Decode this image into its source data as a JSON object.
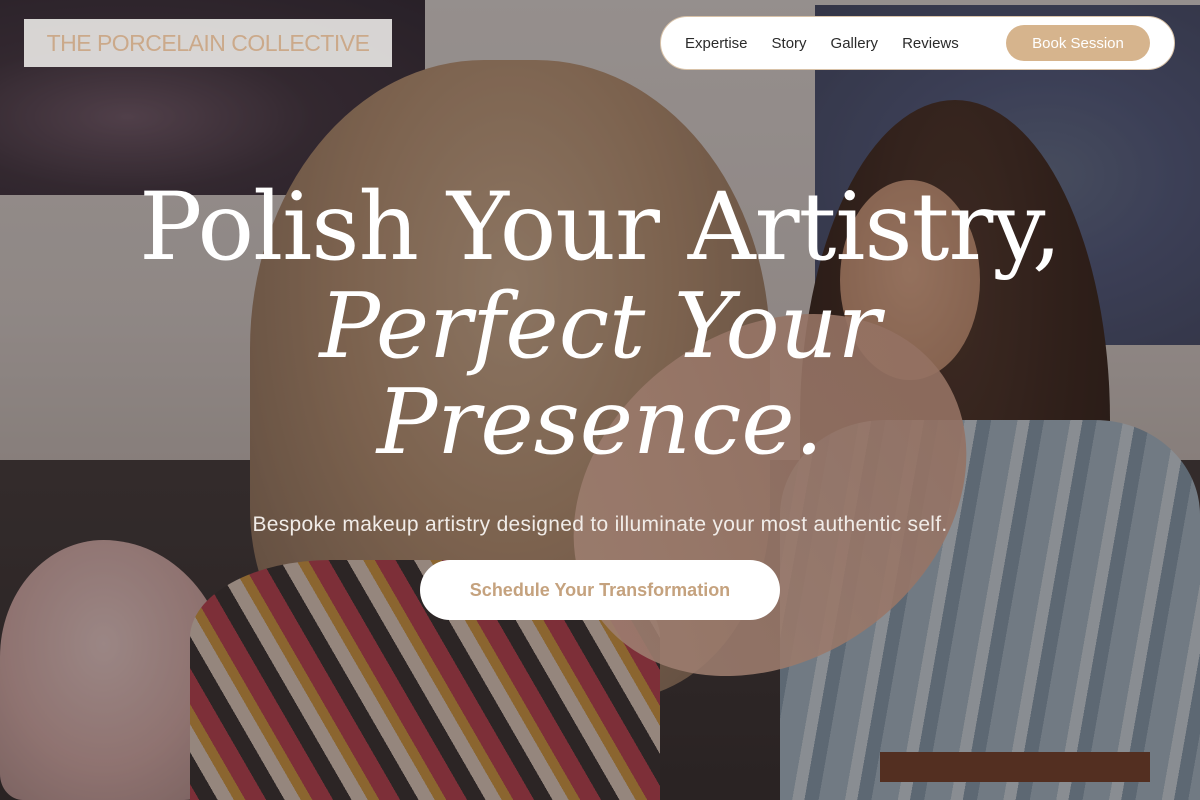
{
  "brand": {
    "name": "THE PORCELAIN COLLECTIVE"
  },
  "nav": {
    "links": [
      {
        "label": "Expertise"
      },
      {
        "label": "Story"
      },
      {
        "label": "Gallery"
      },
      {
        "label": "Reviews"
      }
    ],
    "cta_label": "Book Session"
  },
  "hero": {
    "headline_line1": "Polish Your Artistry,",
    "headline_line2": "Perfect Your",
    "headline_line3": "Presence.",
    "subtitle": "Bespoke makeup artistry designed to illuminate your most authentic self.",
    "cta_label": "Schedule Your Transformation"
  },
  "colors": {
    "accent": "#d6b48d",
    "cta_text": "#c5a27e",
    "logo_text": "#cba98a",
    "overlay": "rgba(40,30,28,0.38)"
  }
}
